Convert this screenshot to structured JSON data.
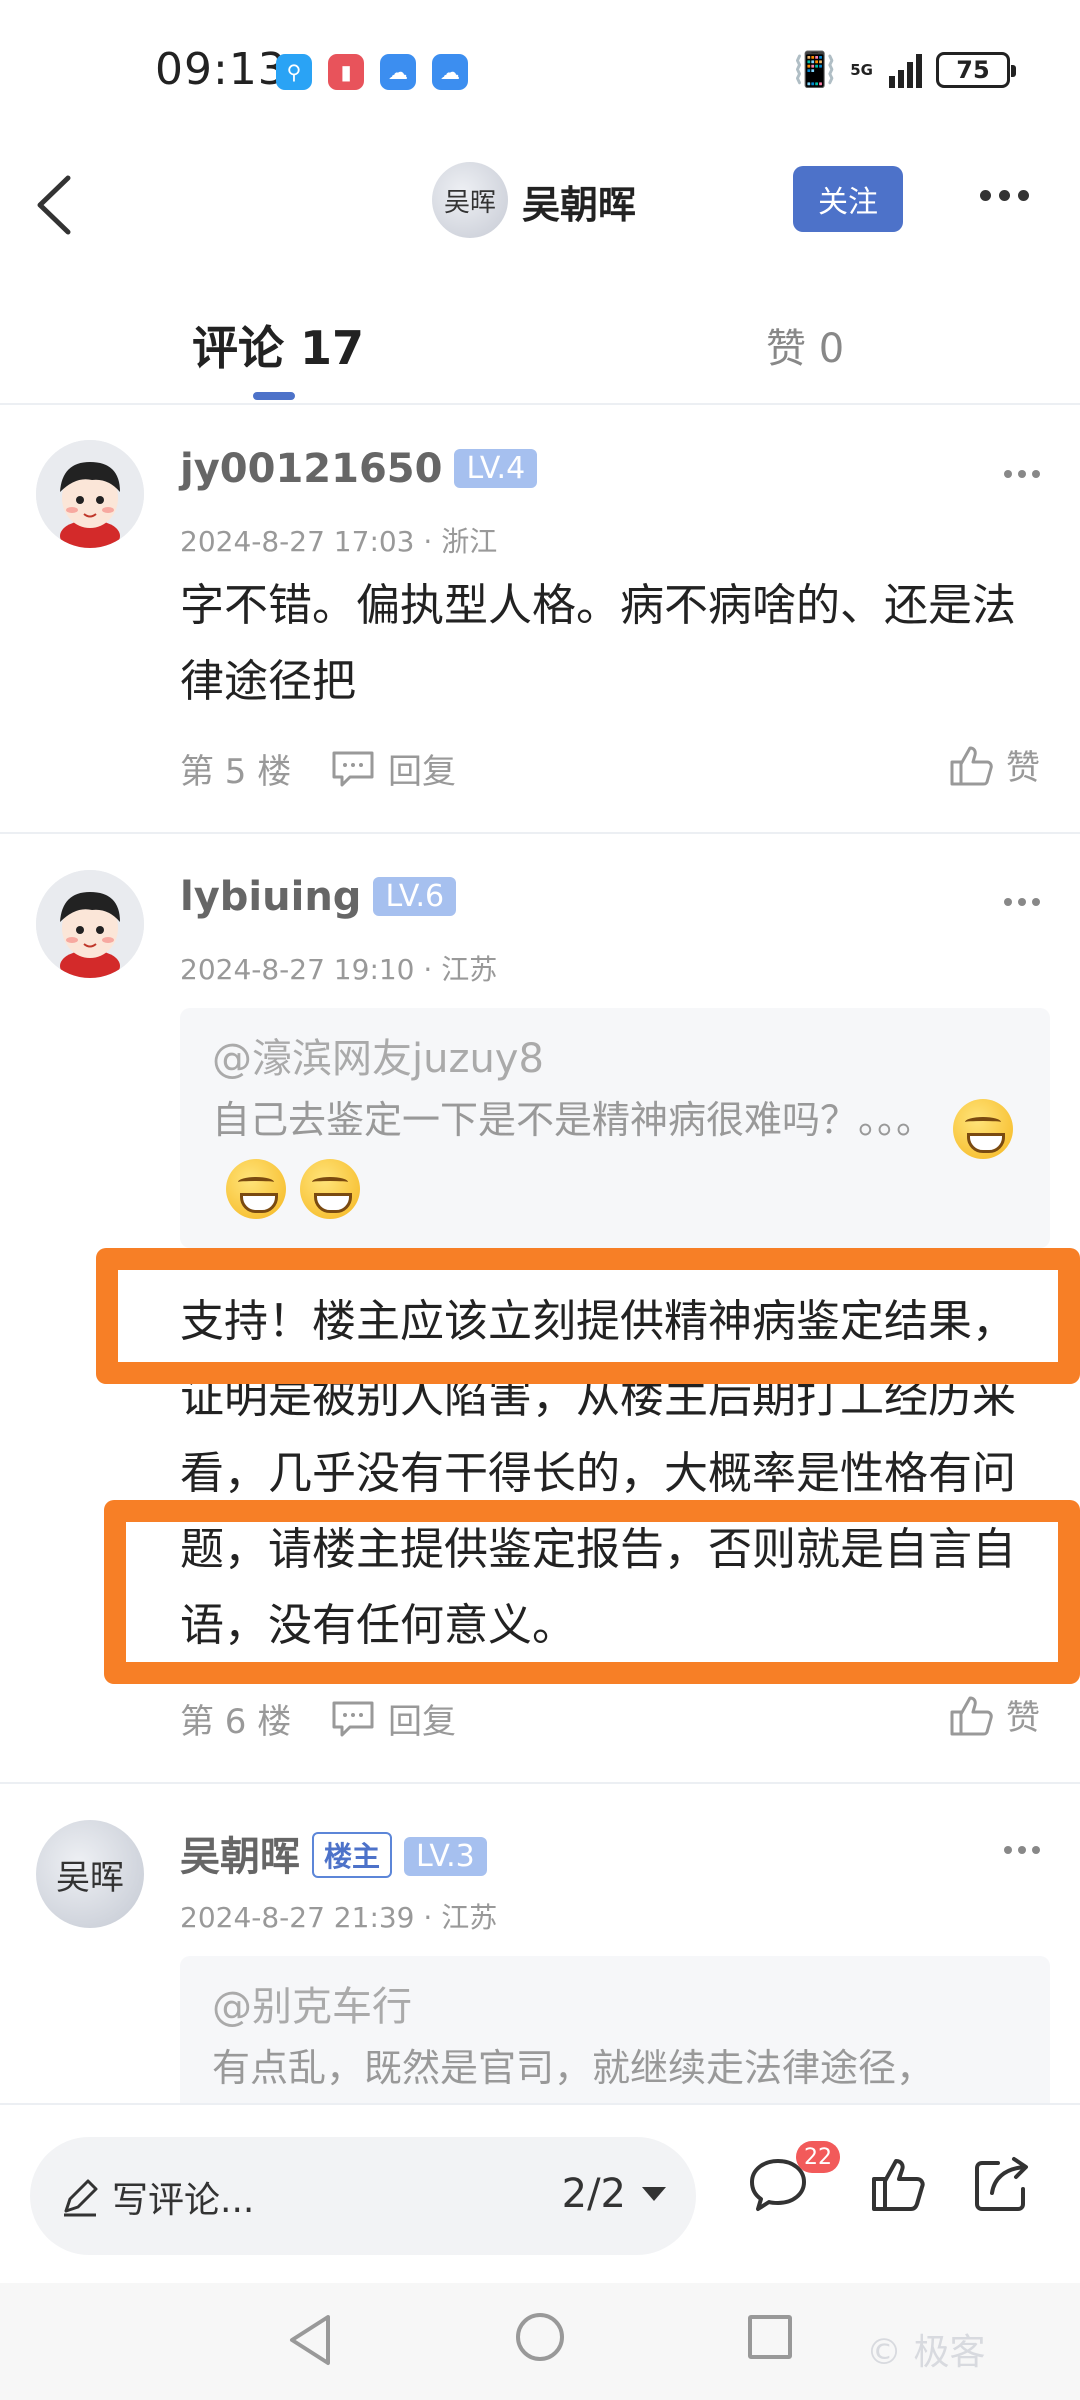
{
  "status_bar": {
    "time": "09:13",
    "network": "5G",
    "battery": "75"
  },
  "header": {
    "author_name": "吴朝晖",
    "author_seal": "吴晖",
    "follow_label": "关注"
  },
  "tabs": {
    "comments_label": "评论 17",
    "likes_label": "赞 0"
  },
  "comments": [
    {
      "user": "jy00121650",
      "level": "LV.4",
      "time": "2024-8-27 17:03 · 浙江",
      "text": "字不错。偏执型人格。病不病啥的、还是法律途径把",
      "floor": "第 5 楼",
      "reply_label": "回复",
      "like_label": "赞"
    },
    {
      "user": "lybiuing",
      "level": "LV.6",
      "time": "2024-8-27 19:10 · 江苏",
      "quote": {
        "user": "@濠滨网友juzuy8",
        "text": "自己去鉴定一下是不是精神病很难吗？。。。"
      },
      "text": "支持！楼主应该立刻提供精神病鉴定结果，证明是被别人陷害，从楼主后期打工经历来看，几乎没有干得长的，大概率是性格有问题，请楼主提供鉴定报告，否则就是自言自语，没有任何意义。",
      "floor": "第 6 楼",
      "reply_label": "回复",
      "like_label": "赞"
    },
    {
      "user": "吴朝晖",
      "op_badge": "楼主",
      "level": "LV.3",
      "time": "2024-8-27 21:39 · 江苏",
      "quote": {
        "user": "@别克车行",
        "text": "有点乱，既然是官司，就继续走法律途径，"
      }
    }
  ],
  "bottom_bar": {
    "write_placeholder": "写评论...",
    "page": "2/2",
    "comment_count": "22"
  },
  "watermark": "©  极客",
  "colors": {
    "accent": "#4d72c9",
    "highlight": "#f77f26",
    "level_badge": "#a6c0ef"
  }
}
